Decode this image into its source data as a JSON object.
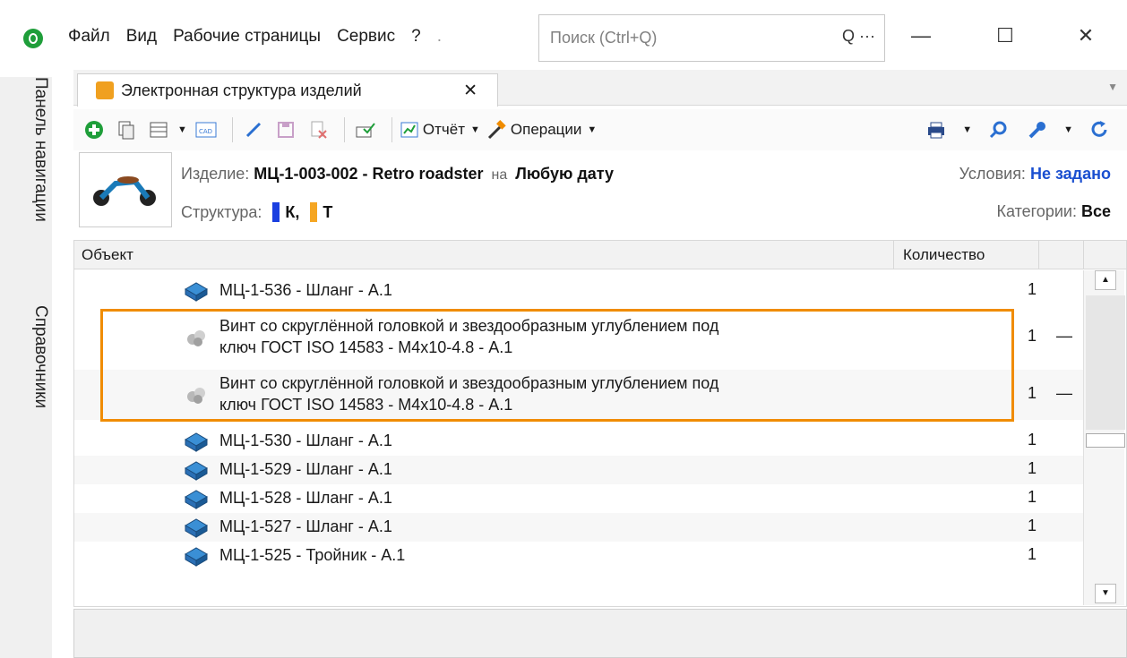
{
  "menu": [
    "Файл",
    "Вид",
    "Рабочие страницы",
    "Сервис",
    "?",
    "."
  ],
  "search": {
    "placeholder": "Поиск (Ctrl+Q)",
    "icons": "Q ···"
  },
  "window": {
    "minimize": "—",
    "maximize": "☐",
    "close": "✕"
  },
  "vnav": {
    "item1": "Панель навигации",
    "item2": "Справочники"
  },
  "tab": {
    "label": "Электронная структура изделий",
    "close": "✕"
  },
  "toolbar": {
    "report": "Отчёт",
    "operations": "Операции"
  },
  "info": {
    "product_label": "Изделие:",
    "product_value": "МЦ-1-003-002 - Retro roadster",
    "on_label": "на",
    "date_value": "Любую дату",
    "structure_label": "Структура:",
    "structure_k": "К,",
    "structure_t": "Т",
    "conditions_label": "Условия:",
    "conditions_value": "Не задано",
    "categories_label": "Категории:",
    "categories_value": "Все",
    "colors": {
      "k": "#1a3fe0",
      "t": "#f5a623"
    }
  },
  "grid": {
    "col_object": "Объект",
    "col_qty": "Количество",
    "rows": [
      {
        "name": "МЦ-1-536 - Шланг - А.1",
        "qty": "1",
        "icon": "part-icon"
      },
      {
        "name1": "Винт со скруглённой головкой и звездообразным углублением под",
        "name2": "ключ ГОСТ ISO 14583 - M4x10-4.8 - А.1",
        "qty": "1",
        "dash": "—",
        "icon": "standard-part-icon"
      },
      {
        "name1": "Винт со скруглённой головкой и звездообразным углублением под",
        "name2": "ключ ГОСТ ISO 14583 - M4x10-4.8 - А.1",
        "qty": "1",
        "dash": "—",
        "icon": "standard-part-icon"
      },
      {
        "name": "МЦ-1-530 - Шланг - А.1",
        "qty": "1",
        "icon": "part-icon"
      },
      {
        "name": "МЦ-1-529 - Шланг - А.1",
        "qty": "1",
        "icon": "part-icon"
      },
      {
        "name": "МЦ-1-528 - Шланг - А.1",
        "qty": "1",
        "icon": "part-icon"
      },
      {
        "name": "МЦ-1-527 - Шланг - А.1",
        "qty": "1",
        "icon": "part-icon"
      },
      {
        "name": "МЦ-1-525 - Тройник - А.1",
        "qty": "1",
        "icon": "part-icon"
      }
    ]
  },
  "accent": "#f08c00"
}
